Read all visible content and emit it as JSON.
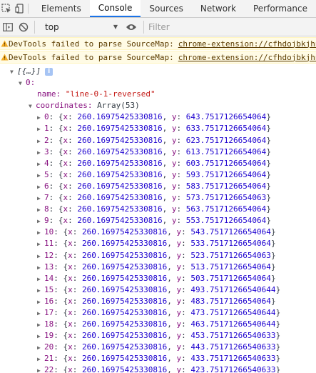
{
  "tabs": [
    "Elements",
    "Console",
    "Sources",
    "Network",
    "Performance"
  ],
  "active_tab": "Console",
  "toolbar": {
    "context": "top",
    "filter_placeholder": "Filter"
  },
  "warnings": [
    {
      "text": "DevTools failed to parse SourceMap:",
      "link": "chrome-extension://cfhdojbkjhnklbpkdaibdccddilifddb/"
    },
    {
      "text": "DevTools failed to parse SourceMap:",
      "link": "chrome-extension://cfhdojbkjhnklbpkdaibdccddilifddb/"
    }
  ],
  "tree": {
    "root_label": "[{…}]",
    "info_badge": "i",
    "item_index": "0:",
    "name_key": "name:",
    "name_value": "\"line-0-1-reversed\"",
    "coords_key": "coordinates:",
    "coords_summary": "Array(53)",
    "points": [
      {
        "i": "0",
        "x": "260.16975425330816",
        "y": "643.7517126654064"
      },
      {
        "i": "1",
        "x": "260.16975425330816",
        "y": "633.7517126654064"
      },
      {
        "i": "2",
        "x": "260.16975425330816",
        "y": "623.7517126654064"
      },
      {
        "i": "3",
        "x": "260.16975425330816",
        "y": "613.7517126654064"
      },
      {
        "i": "4",
        "x": "260.16975425330816",
        "y": "603.7517126654064"
      },
      {
        "i": "5",
        "x": "260.16975425330816",
        "y": "593.7517126654064"
      },
      {
        "i": "6",
        "x": "260.16975425330816",
        "y": "583.7517126654064"
      },
      {
        "i": "7",
        "x": "260.16975425330816",
        "y": "573.7517126654063"
      },
      {
        "i": "8",
        "x": "260.16975425330816",
        "y": "563.7517126654064"
      },
      {
        "i": "9",
        "x": "260.16975425330816",
        "y": "553.7517126654064"
      },
      {
        "i": "10",
        "x": "260.16975425330816",
        "y": "543.7517126654064"
      },
      {
        "i": "11",
        "x": "260.16975425330816",
        "y": "533.7517126654064"
      },
      {
        "i": "12",
        "x": "260.16975425330816",
        "y": "523.7517126654063"
      },
      {
        "i": "13",
        "x": "260.16975425330816",
        "y": "513.7517126654064"
      },
      {
        "i": "14",
        "x": "260.16975425330816",
        "y": "503.7517126654064"
      },
      {
        "i": "15",
        "x": "260.16975425330816",
        "y": "493.75171266540644"
      },
      {
        "i": "16",
        "x": "260.16975425330816",
        "y": "483.7517126654064"
      },
      {
        "i": "17",
        "x": "260.16975425330816",
        "y": "473.75171266540644"
      },
      {
        "i": "18",
        "x": "260.16975425330816",
        "y": "463.75171266540644"
      },
      {
        "i": "19",
        "x": "260.16975425330816",
        "y": "453.75171266540633"
      },
      {
        "i": "20",
        "x": "260.16975425330816",
        "y": "443.75171266540633"
      },
      {
        "i": "21",
        "x": "260.16975425330816",
        "y": "433.75171266540633"
      },
      {
        "i": "22",
        "x": "260.16975425330816",
        "y": "423.75171266540633"
      }
    ]
  }
}
